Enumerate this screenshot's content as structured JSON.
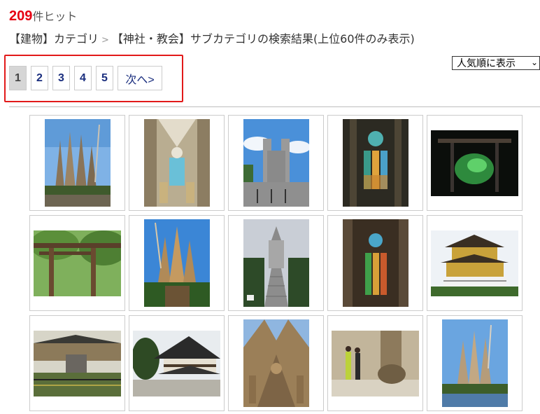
{
  "results": {
    "count": "209",
    "count_suffix": "件ヒット"
  },
  "breadcrumb": {
    "category": "【建物】カテゴリ",
    "separator": ">",
    "subcategory": "【神社・教会】",
    "suffix": "サブカテゴリの検索結果(上位60件のみ表示)"
  },
  "sort": {
    "selected": "人気順に表示",
    "chevron": "⌄"
  },
  "pagination": {
    "pages": [
      "1",
      "2",
      "3",
      "4",
      "5"
    ],
    "current": "1",
    "next_label": "次へ>"
  },
  "colors": {
    "count": "#e60012",
    "highlight_border": "#e21a1a",
    "page_link": "#1a2e7e"
  },
  "gallery": {
    "columns": 5,
    "items": [
      {
        "name": "sagrada-familia-towers-thumbnail",
        "orientation": "portrait"
      },
      {
        "name": "sagrada-familia-nave-thumbnail",
        "orientation": "portrait"
      },
      {
        "name": "cathedral-facade-thumbnail",
        "orientation": "portrait"
      },
      {
        "name": "stained-glass-interior-thumbnail",
        "orientation": "portrait"
      },
      {
        "name": "torii-night-thumbnail",
        "orientation": "landscape"
      },
      {
        "name": "torii-gate-trees-thumbnail",
        "orientation": "landscape"
      },
      {
        "name": "sagrada-familia-facade-thumbnail",
        "orientation": "portrait"
      },
      {
        "name": "church-steps-thumbnail",
        "orientation": "portrait"
      },
      {
        "name": "stained-glass-window-thumbnail",
        "orientation": "portrait"
      },
      {
        "name": "golden-pavilion-thumbnail",
        "orientation": "landscape"
      },
      {
        "name": "temple-garden-stone-thumbnail",
        "orientation": "landscape"
      },
      {
        "name": "temple-roof-thumbnail",
        "orientation": "landscape"
      },
      {
        "name": "nativity-facade-detail-thumbnail",
        "orientation": "portrait"
      },
      {
        "name": "church-interior-column-thumbnail",
        "orientation": "landscape"
      },
      {
        "name": "sagrada-familia-lake-thumbnail",
        "orientation": "portrait"
      }
    ]
  }
}
